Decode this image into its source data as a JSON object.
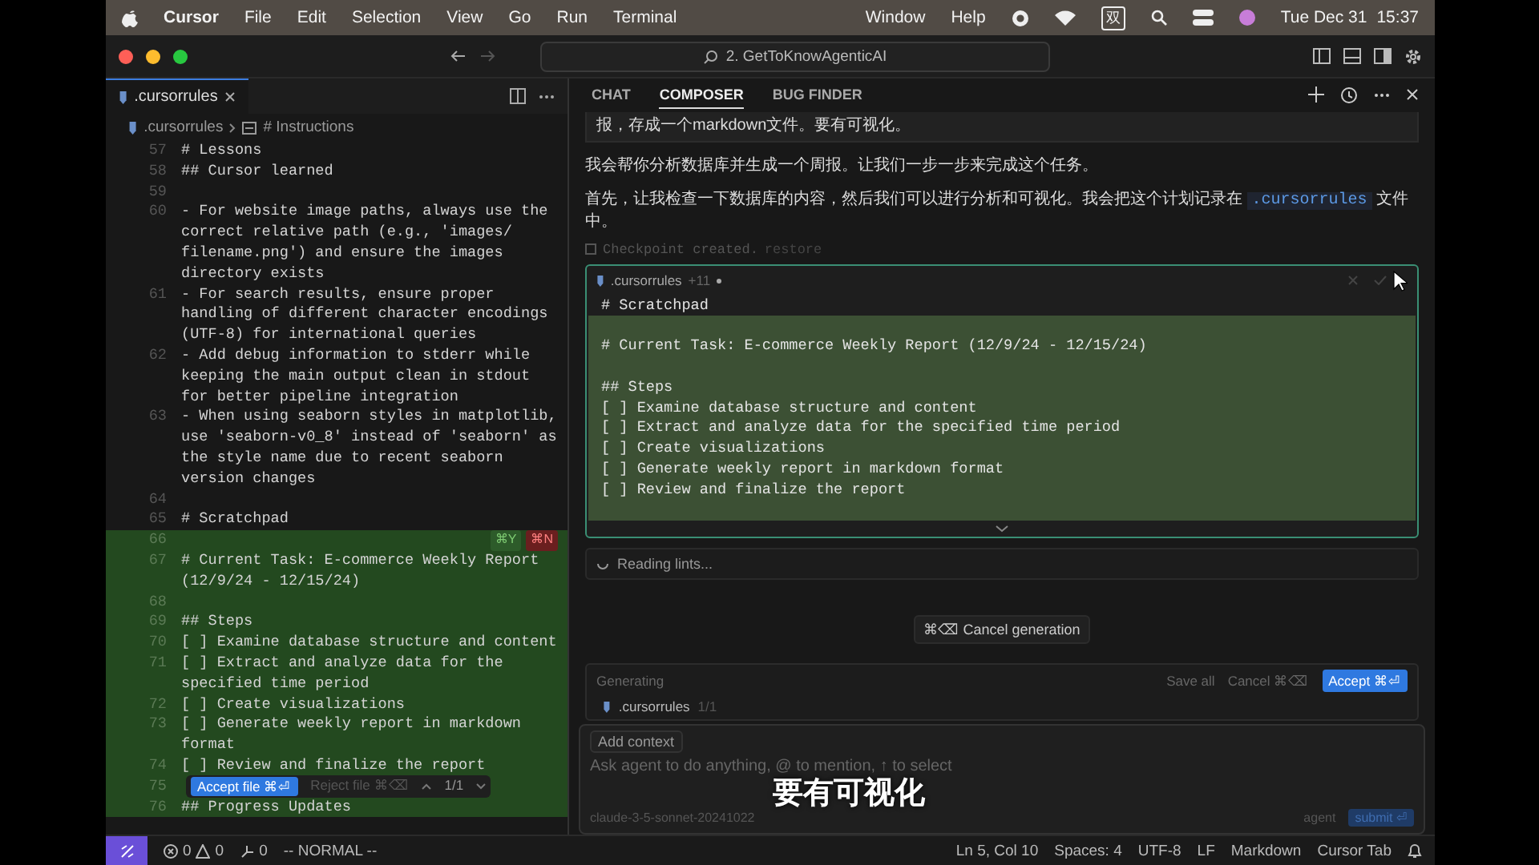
{
  "menu_bar": {
    "app": "Cursor",
    "items": [
      "File",
      "Edit",
      "Selection",
      "View",
      "Go",
      "Run",
      "Terminal"
    ],
    "right_items": [
      "Window",
      "Help"
    ],
    "input_method": "双",
    "date": "Tue Dec 31",
    "time": "15:37"
  },
  "window": {
    "search": "2. GetToKnowAgenticAI"
  },
  "editor": {
    "tab": {
      "label": ".cursorrules",
      "selected": true
    },
    "breadcrumb": [
      ".cursorrules",
      "# Instructions"
    ],
    "lines": [
      {
        "number": "57",
        "rows": [
          "# Lessons"
        ],
        "added": false
      },
      {
        "number": "58",
        "rows": [
          "## Cursor learned"
        ],
        "added": false
      },
      {
        "number": "59",
        "added": false
      },
      {
        "number": "60",
        "rows": [
          "- For website image paths, always use the",
          "correct relative path (e.g., 'images/",
          "filename.png') and ensure the images",
          "directory exists"
        ],
        "added": false
      },
      {
        "number": "61",
        "rows": [
          "- For search results, ensure proper",
          "handling of different character encodings",
          "(UTF-8) for international queries"
        ],
        "added": false
      },
      {
        "number": "62",
        "rows": [
          "- Add debug information to stderr while",
          "keeping the main output clean in stdout",
          "for better pipeline integration"
        ],
        "added": false
      },
      {
        "number": "63",
        "rows": [
          "- When using seaborn styles in matplotlib,",
          "use 'seaborn-v0_8' instead of 'seaborn' as",
          "the style name due to recent seaborn",
          "version changes"
        ],
        "added": false
      },
      {
        "number": "64",
        "added": false
      },
      {
        "number": "65",
        "rows": [
          "# Scratchpad"
        ],
        "added": false
      },
      {
        "number": "66",
        "added": true
      },
      {
        "number": "67",
        "rows": [
          "# Current Task: E-commerce Weekly Report",
          "(12/9/24 - 12/15/24)"
        ],
        "added": true
      },
      {
        "number": "68",
        "added": true
      },
      {
        "number": "69",
        "rows": [
          "## Steps"
        ],
        "added": true
      },
      {
        "number": "70",
        "rows": [
          "[ ] Examine database structure and content"
        ],
        "added": true
      },
      {
        "number": "71",
        "rows": [
          "[ ] Extract and analyze data for the",
          "specified time period"
        ],
        "added": true
      },
      {
        "number": "72",
        "rows": [
          "[ ] Create visualizations"
        ],
        "added": true
      },
      {
        "number": "73",
        "rows": [
          "[ ] Generate weekly report in markdown",
          "format"
        ],
        "added": true
      },
      {
        "number": "74",
        "rows": [
          "[ ] Review and finalize the report"
        ],
        "added": true
      },
      {
        "number": "75",
        "added": true
      },
      {
        "number": "76",
        "rows": [
          "## Progress Updates"
        ],
        "added": true
      }
    ],
    "change_keys": {
      "accept": "⌘Y",
      "reject": "⌘N"
    },
    "review_bar": {
      "accept": "Accept file ⌘⏎",
      "reject": "Reject file ⌘⌫",
      "count": "1/1"
    }
  },
  "chat": {
    "tabs": [
      {
        "label": "CHAT",
        "selected": false
      },
      {
        "label": "COMPOSER",
        "selected": true
      },
      {
        "label": "BUG FINDER",
        "selected": false
      }
    ],
    "user_message": "报，存成一个markdown文件。要有可视化。",
    "reply": [
      {
        "before": "我会帮你分析数据库并生成一个周报。让我们一步一步来完成这个任务。"
      },
      {
        "before": "首先，让我检查一下数据库的内容，然后我们可以进行分析和可视化。我会把这个计划记录在 ",
        "code": ".cursorrules",
        "after": " 文件中。"
      }
    ],
    "checkpoint": {
      "text": "Checkpoint created.",
      "link": "restore"
    },
    "code_card": {
      "file": ".cursorrules",
      "changes": "+11",
      "rows": [
        {
          "text": "# Scratchpad",
          "added": false
        },
        {
          "text": "",
          "added": true
        },
        {
          "text": "# Current Task: E-commerce Weekly Report (12/9/24 - 12/15/24)",
          "added": true
        },
        {
          "text": "",
          "added": true
        },
        {
          "text": "## Steps",
          "added": true
        },
        {
          "text": "[ ] Examine database structure and content",
          "added": true
        },
        {
          "text": "[ ] Extract and analyze data for the specified time period",
          "added": true
        },
        {
          "text": "[ ] Create visualizations",
          "added": true
        },
        {
          "text": "[ ] Generate weekly report in markdown format",
          "added": true
        },
        {
          "text": "[ ] Review and finalize the report",
          "added": true
        },
        {
          "text": "",
          "added": true
        }
      ]
    },
    "status": "Reading lints...",
    "cancel": "⌘⌫ Cancel generation",
    "generating": {
      "label": "Generating",
      "save_all": "Save all",
      "cancel": "Cancel ⌘⌫",
      "accept": "Accept ⌘⏎",
      "file": ".cursorrules",
      "count": "1/1"
    },
    "composer": {
      "add_context": "Add context",
      "placeholder": "Ask agent to do anything, @ to mention, ↑ to select",
      "model": "claude-3-5-sonnet-20241022",
      "mode": "agent",
      "submit": "submit ⏎"
    }
  },
  "subtitle": "要有可视化",
  "status_bar": {
    "errors": "0",
    "warnings": "0",
    "ports": "0",
    "mode": "-- NORMAL --",
    "items": [
      "Ln 5, Col 10",
      "Spaces: 4",
      "UTF-8",
      "LF",
      "Markdown",
      "Cursor Tab"
    ]
  }
}
